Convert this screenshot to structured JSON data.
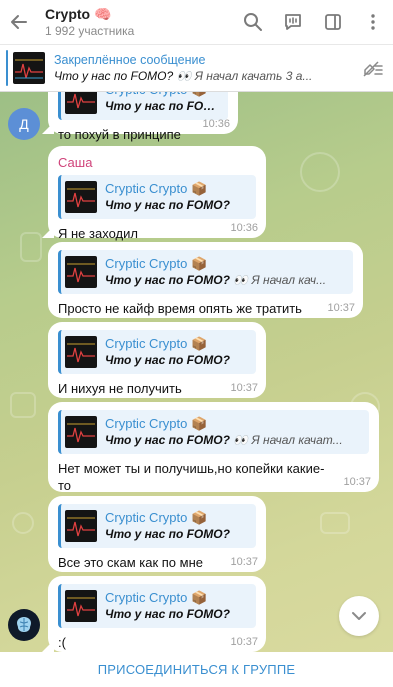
{
  "header": {
    "title": "Crypto 🧠",
    "subtitle": "1 992 участника"
  },
  "pinned": {
    "title": "Закреплённое сообщение",
    "message_bold": "Что у нас по FOMO? 👀",
    "message_rest": " Я начал качать 3 а..."
  },
  "quote": {
    "name": "Cryptic Crypto 📦",
    "text": "Что у нас по FOMO?",
    "text_long": "Что у нас по FOMO? 👀",
    "rest_1": " Я начал кач...",
    "rest_2": " Я начал качат..."
  },
  "messages": [
    {
      "text": "то похуй в принципе",
      "time": "10:36"
    },
    {
      "sender": "Саша",
      "text": "Я не заходил",
      "time": "10:36"
    },
    {
      "text": "Просто не кайф время опять же тратить",
      "time": "10:37"
    },
    {
      "text": "И нихуя не получить",
      "time": "10:37"
    },
    {
      "text": "Нет может ты и получишь,но копейки какие-то",
      "time": "10:37"
    },
    {
      "text": "Все это скам как по мне",
      "time": "10:37"
    },
    {
      "text": ":(",
      "time": "10:37"
    }
  ],
  "avatars": {
    "d_letter": "Д"
  },
  "footer": {
    "join_label": "ПРИСОЕДИНИТЬСЯ К ГРУППЕ"
  },
  "colors": {
    "accent": "#3a8fd0",
    "sender": "#d0437a",
    "bubble": "#ffffff",
    "quote_bg": "#eaf3fb"
  },
  "icons": [
    "back-arrow-icon",
    "search-icon",
    "voice-chat-icon",
    "sidebar-icon",
    "more-icon",
    "unpin-list-icon",
    "chevron-down-icon",
    "brain-avatar-icon"
  ]
}
